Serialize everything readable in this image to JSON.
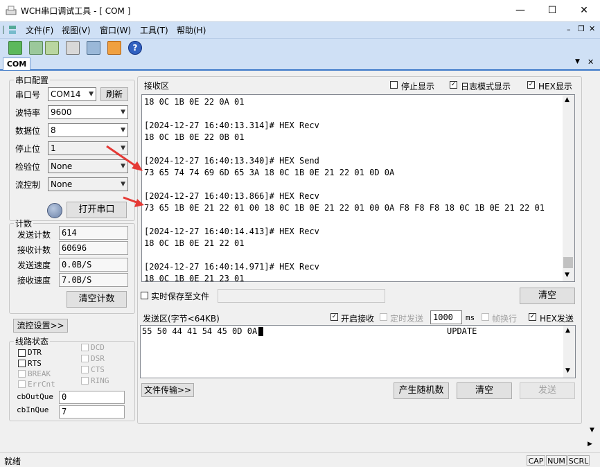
{
  "window": {
    "title": "WCH串口调试工具 - [ COM ]",
    "minimize": "—",
    "maximize": "☐",
    "close": "✕"
  },
  "menu": {
    "items": [
      "文件(F)",
      "视图(V)",
      "窗口(W)",
      "工具(T)",
      "帮助(H)"
    ]
  },
  "toolbar": {
    "icons": [
      "new-icon",
      "split-horizontal-icon",
      "split-vertical-icon",
      "calculator-icon",
      "monitor-icon",
      "upgrade-icon",
      "help-icon"
    ]
  },
  "tab": {
    "label": "COM"
  },
  "serial_config": {
    "group_label": "串口配置",
    "port_label": "串口号",
    "port_value": "COM14",
    "refresh_label": "刷新",
    "baud_label": "波特率",
    "baud_value": "9600",
    "data_bits_label": "数据位",
    "data_bits_value": "8",
    "stop_bits_label": "停止位",
    "stop_bits_value": "1",
    "parity_label": "检验位",
    "parity_value": "None",
    "flow_label": "流控制",
    "flow_value": "None",
    "open_port_label": "打开串口"
  },
  "counts": {
    "group_label": "计数",
    "send_count_label": "发送计数",
    "send_count_value": "614",
    "recv_count_label": "接收计数",
    "recv_count_value": "60696",
    "send_speed_label": "发送速度",
    "send_speed_value": "0.0B/S",
    "recv_speed_label": "接收速度",
    "recv_speed_value": "7.0B/S",
    "clear_counts_label": "清空计数"
  },
  "flow_settings_label": "流控设置>>",
  "line_status": {
    "group_label": "线路状态",
    "dtr": "DTR",
    "rts": "RTS",
    "break": "BREAK",
    "errcnt": "ErrCnt",
    "dcd": "DCD",
    "dsr": "DSR",
    "cts": "CTS",
    "ring": "RING",
    "cbout_label": "cbOutQue",
    "cbout_value": "0",
    "cbin_label": "cbInQue",
    "cbin_value": "7"
  },
  "receive": {
    "title": "接收区",
    "stop_display": "停止显示",
    "log_mode": "日志模式显示",
    "hex_display": "HEX显示",
    "lines": [
      "18 0C 1B 0E 22 0A 01",
      "",
      "[2024-12-27 16:40:13.314]# HEX Recv",
      "18 0C 1B 0E 22 0B 01",
      "",
      "[2024-12-27 16:40:13.340]# HEX Send",
      "73 65 74 74 69 6D 65 3A 18 0C 1B 0E 21 22 01 0D 0A",
      "",
      "[2024-12-27 16:40:13.866]# HEX Recv",
      "73 65 1B 0E 21 22 01 00 18 0C 1B 0E 21 22 01 00 0A F8 F8 F8 18 0C 1B 0E 21 22 01",
      "",
      "[2024-12-27 16:40:14.413]# HEX Recv",
      "18 0C 1B 0E 21 22 01",
      "",
      "[2024-12-27 16:40:14.971]# HEX Recv",
      "18 0C 1B 0E 21 23 01"
    ],
    "realtime_save": "实时保存至文件",
    "clear_label": "清空"
  },
  "send": {
    "title": "发送区(字节<64KB)",
    "enable_recv": "开启接收",
    "timed_send": "定时发送",
    "interval_value": "1000",
    "interval_unit": "ms",
    "frame_newline": "帧换行",
    "hex_send": "HEX发送",
    "content": "55 50 44 41 54 45 0D 0A",
    "content_ascii": "UPDATE",
    "file_transfer_label": "文件传输>>",
    "random_label": "产生随机数",
    "clear_label": "清空",
    "send_label": "发送"
  },
  "status": {
    "text": "就绪",
    "cap": "CAP",
    "num": "NUM",
    "scrl": "SCRL"
  }
}
